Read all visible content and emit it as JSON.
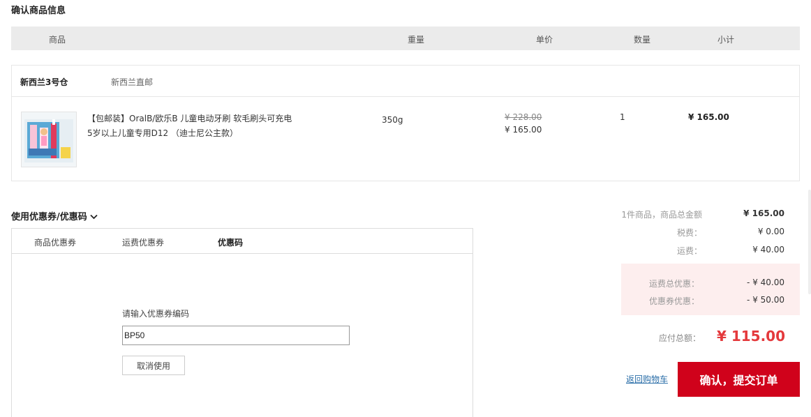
{
  "page": {
    "title": "确认商品信息"
  },
  "table_head": {
    "product": "商品",
    "weight": "重量",
    "unit_price": "单价",
    "quantity": "数量",
    "subtotal": "小计"
  },
  "order": {
    "warehouse": "新西兰3号仓",
    "shipping_method": "新西兰直邮",
    "item": {
      "image_icon": "toothbrush-product-image",
      "name": "【包邮装】OralB/欧乐B 儿童电动牙刷 软毛刷头可充电 5岁以上儿童专用D12 （迪士尼公主款）",
      "weight": "350g",
      "price_original": "¥ 228.00",
      "price_current": "¥ 165.00",
      "quantity": "1",
      "subtotal": "¥ 165.00"
    }
  },
  "coupon": {
    "title": "使用优惠券/优惠码",
    "tabs": [
      "商品优惠券",
      "运费优惠券",
      "优惠码"
    ],
    "active_tab": "优惠码",
    "code_label": "请输入优惠券编码",
    "code_value": "BP50",
    "cancel_label": "取消使用"
  },
  "summary": {
    "goods_total_label": "1件商品，商品总金额",
    "goods_total_value": "¥ 165.00",
    "tax_label": "税费：",
    "tax_value": "¥ 0.00",
    "shipping_label": "运费：",
    "shipping_value": "¥ 40.00",
    "shipping_discount_label": "运费总优惠：",
    "shipping_discount_value": "- ¥ 40.00",
    "coupon_discount_label": "优惠券优惠：",
    "coupon_discount_value": "- ¥ 50.00",
    "total_label": "应付总额：",
    "total_value": "¥ 115.00"
  },
  "actions": {
    "back_label": "返回购物车",
    "submit_label": "确认，提交订单"
  },
  "colors": {
    "accent_red": "#d0021b",
    "total_red": "#e4393c",
    "header_gray": "#ebebeb",
    "discount_bg": "#fdeeee",
    "link_blue": "#2a6ea8"
  }
}
